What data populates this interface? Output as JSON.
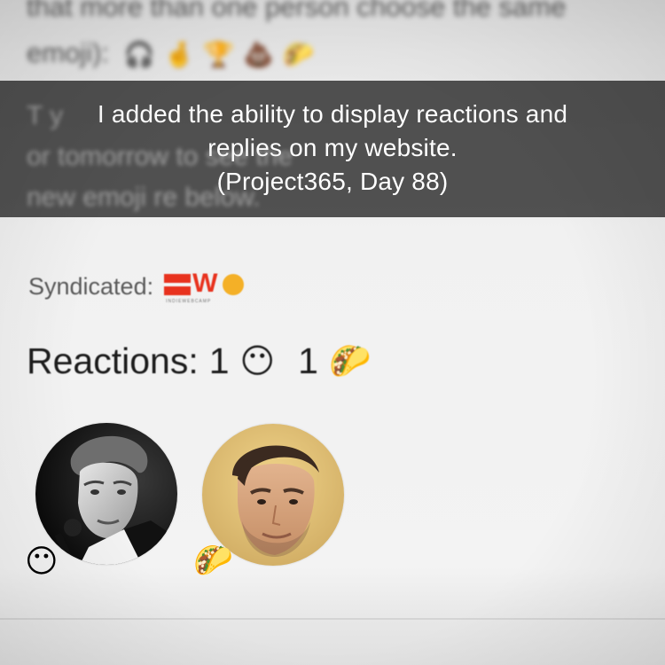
{
  "top_blurred": {
    "line1": "that more than one person choose the same",
    "line2_prefix": "emoji):",
    "emojis": [
      "🎧",
      "🤞",
      "🏆",
      "💩",
      "🌮"
    ]
  },
  "caption": {
    "line1": "I added the ability to display reactions and",
    "line2": "replies on my website.",
    "line3": "(Project365, Day 88)"
  },
  "under_caption_blurred": {
    "line1": "T                                                         y",
    "line2": "or tomorrow                        to see the",
    "line3": "new emoji re                   below."
  },
  "syndicated": {
    "label": "Syndicated:",
    "logo_letter_w": "W",
    "logo_sub": "INDIEWEBCAMP"
  },
  "reactions": {
    "label": "Reactions:",
    "items": [
      {
        "count": "1",
        "emoji": "😶"
      },
      {
        "count": "1",
        "emoji": "🌮"
      }
    ]
  },
  "avatars": [
    {
      "name": "avatar-1",
      "badge": "😶"
    },
    {
      "name": "avatar-2",
      "badge": "🌮"
    }
  ],
  "colors": {
    "caption_band": "#2d2d2d",
    "iwc_red": "#e8321e",
    "iwc_orange": "#f4b027",
    "text_dark": "#1c1c1c"
  }
}
